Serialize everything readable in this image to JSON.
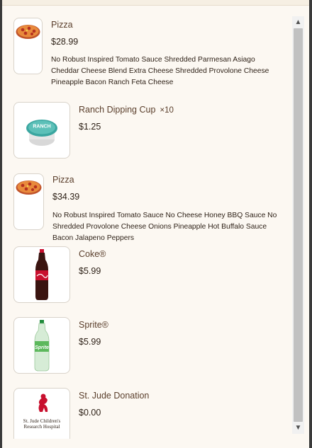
{
  "items": [
    {
      "name": "Pizza",
      "price": "$28.99",
      "description": "No Robust Inspired Tomato Sauce Shredded Parmesan Asiago Cheddar Cheese Blend Extra Cheese Shredded Provolone Cheese Pineapple Bacon Ranch Feta Cheese",
      "image_icon": "pizza-icon"
    },
    {
      "name": "Ranch Dipping Cup",
      "quantity": "×10",
      "price": "$1.25",
      "image_icon": "ranch-cup-icon",
      "image_label": "RANCH"
    },
    {
      "name": "Pizza",
      "price": "$34.39",
      "description": "No Robust Inspired Tomato Sauce No Cheese Honey BBQ Sauce No Shredded Provolone Cheese Onions Pineapple Hot Buffalo Sauce Bacon Jalapeno Peppers",
      "image_icon": "pizza-icon"
    },
    {
      "name": "Coke®",
      "price": "$5.99",
      "image_icon": "coke-bottle-icon"
    },
    {
      "name": "Sprite®",
      "price": "$5.99",
      "image_icon": "sprite-bottle-icon"
    },
    {
      "name": "St. Jude Donation",
      "price": "$0.00",
      "image_icon": "st-jude-logo-icon",
      "image_label": "St. Jude Children's Research Hospital"
    }
  ],
  "colors": {
    "background": "#fcf8f2",
    "text": "#3b2a1e",
    "coke_red": "#c8102e",
    "sprite_green": "#5cb85c"
  }
}
